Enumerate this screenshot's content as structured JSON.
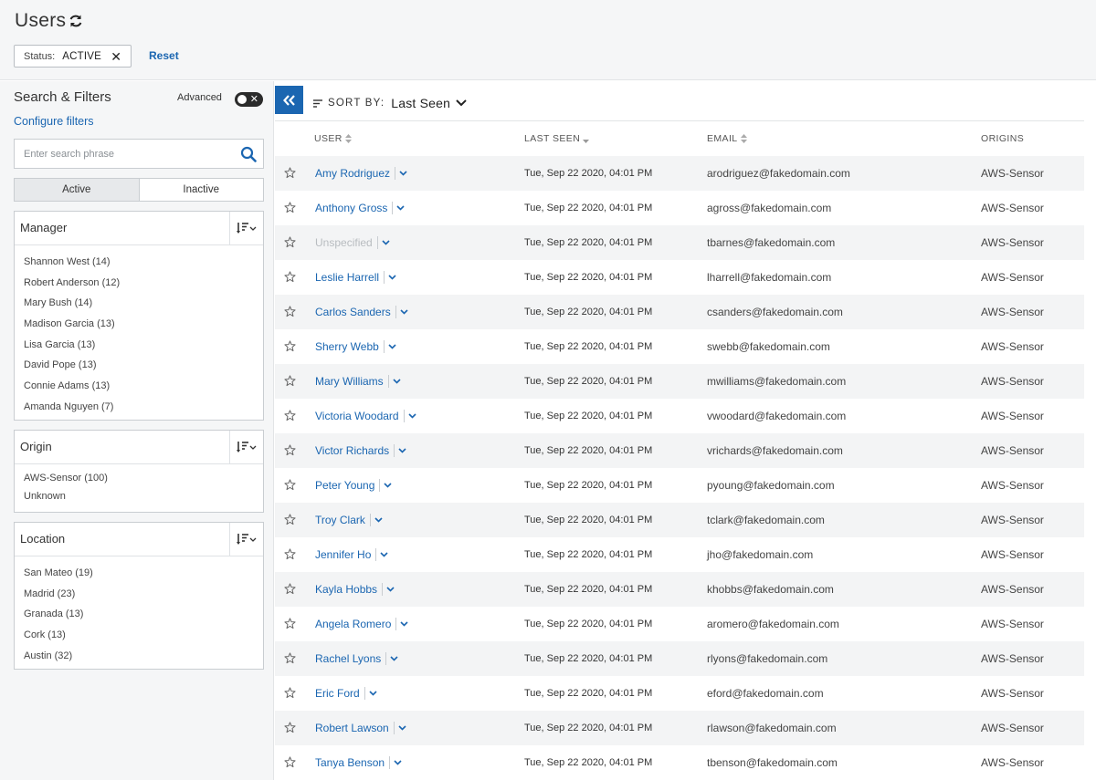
{
  "header": {
    "title": "Users",
    "refresh_icon": "refresh-icon",
    "filter_chip": {
      "label": "Status:",
      "value": "ACTIVE",
      "close_icon": "close-icon"
    },
    "reset_label": "Reset"
  },
  "sidebar": {
    "title": "Search & Filters",
    "advanced_label": "Advanced",
    "advanced_toggle": "off",
    "configure_label": "Configure filters",
    "search": {
      "placeholder": "Enter search phrase",
      "value": ""
    },
    "status_tabs": [
      {
        "label": "Active",
        "selected": true
      },
      {
        "label": "Inactive",
        "selected": false
      }
    ],
    "panels": [
      {
        "title": "Manager",
        "items": [
          "Shannon West (14)",
          "Robert Anderson (12)",
          "Mary Bush (14)",
          "Madison Garcia (13)",
          "Lisa Garcia (13)",
          "David Pope (13)",
          "Connie Adams (13)",
          "Amanda Nguyen (7)"
        ]
      },
      {
        "title": "Origin",
        "items": [
          "AWS-Sensor (100)",
          "Unknown"
        ]
      },
      {
        "title": "Location",
        "items": [
          "San Mateo (19)",
          "Madrid (23)",
          "Granada (13)",
          "Cork (13)",
          "Austin (32)"
        ]
      }
    ]
  },
  "main": {
    "sort": {
      "label": "SORT BY:",
      "value": "Last Seen"
    },
    "columns": {
      "user": "USER",
      "last_seen": "LAST SEEN",
      "email": "EMAIL",
      "origins": "ORIGINS"
    },
    "rows": [
      {
        "user": "Amy Rodriguez",
        "last_seen": "Tue, Sep 22 2020, 04:01 PM",
        "email": "arodriguez@fakedomain.com",
        "origin": "AWS-Sensor"
      },
      {
        "user": "Anthony Gross",
        "last_seen": "Tue, Sep 22 2020, 04:01 PM",
        "email": "agross@fakedomain.com",
        "origin": "AWS-Sensor"
      },
      {
        "user": "Unspecified",
        "last_seen": "Tue, Sep 22 2020, 04:01 PM",
        "email": "tbarnes@fakedomain.com",
        "origin": "AWS-Sensor",
        "unspecified": true
      },
      {
        "user": "Leslie Harrell",
        "last_seen": "Tue, Sep 22 2020, 04:01 PM",
        "email": "lharrell@fakedomain.com",
        "origin": "AWS-Sensor"
      },
      {
        "user": "Carlos Sanders",
        "last_seen": "Tue, Sep 22 2020, 04:01 PM",
        "email": "csanders@fakedomain.com",
        "origin": "AWS-Sensor"
      },
      {
        "user": "Sherry Webb",
        "last_seen": "Tue, Sep 22 2020, 04:01 PM",
        "email": "swebb@fakedomain.com",
        "origin": "AWS-Sensor"
      },
      {
        "user": "Mary Williams",
        "last_seen": "Tue, Sep 22 2020, 04:01 PM",
        "email": "mwilliams@fakedomain.com",
        "origin": "AWS-Sensor"
      },
      {
        "user": "Victoria Woodard",
        "last_seen": "Tue, Sep 22 2020, 04:01 PM",
        "email": "vwoodard@fakedomain.com",
        "origin": "AWS-Sensor"
      },
      {
        "user": "Victor Richards",
        "last_seen": "Tue, Sep 22 2020, 04:01 PM",
        "email": "vrichards@fakedomain.com",
        "origin": "AWS-Sensor"
      },
      {
        "user": "Peter Young",
        "last_seen": "Tue, Sep 22 2020, 04:01 PM",
        "email": "pyoung@fakedomain.com",
        "origin": "AWS-Sensor"
      },
      {
        "user": "Troy Clark",
        "last_seen": "Tue, Sep 22 2020, 04:01 PM",
        "email": "tclark@fakedomain.com",
        "origin": "AWS-Sensor"
      },
      {
        "user": "Jennifer Ho",
        "last_seen": "Tue, Sep 22 2020, 04:01 PM",
        "email": "jho@fakedomain.com",
        "origin": "AWS-Sensor"
      },
      {
        "user": "Kayla Hobbs",
        "last_seen": "Tue, Sep 22 2020, 04:01 PM",
        "email": "khobbs@fakedomain.com",
        "origin": "AWS-Sensor"
      },
      {
        "user": "Angela Romero",
        "last_seen": "Tue, Sep 22 2020, 04:01 PM",
        "email": "aromero@fakedomain.com",
        "origin": "AWS-Sensor"
      },
      {
        "user": "Rachel Lyons",
        "last_seen": "Tue, Sep 22 2020, 04:01 PM",
        "email": "rlyons@fakedomain.com",
        "origin": "AWS-Sensor"
      },
      {
        "user": "Eric Ford",
        "last_seen": "Tue, Sep 22 2020, 04:01 PM",
        "email": "eford@fakedomain.com",
        "origin": "AWS-Sensor"
      },
      {
        "user": "Robert Lawson",
        "last_seen": "Tue, Sep 22 2020, 04:01 PM",
        "email": "rlawson@fakedomain.com",
        "origin": "AWS-Sensor"
      },
      {
        "user": "Tanya Benson",
        "last_seen": "Tue, Sep 22 2020, 04:01 PM",
        "email": "tbenson@fakedomain.com",
        "origin": "AWS-Sensor"
      }
    ]
  },
  "colors": {
    "accent": "#1b66b1",
    "panel_bg": "#f5f6f7",
    "row_alt": "#f3f4f5",
    "muted_user": "#b8bcc0"
  }
}
